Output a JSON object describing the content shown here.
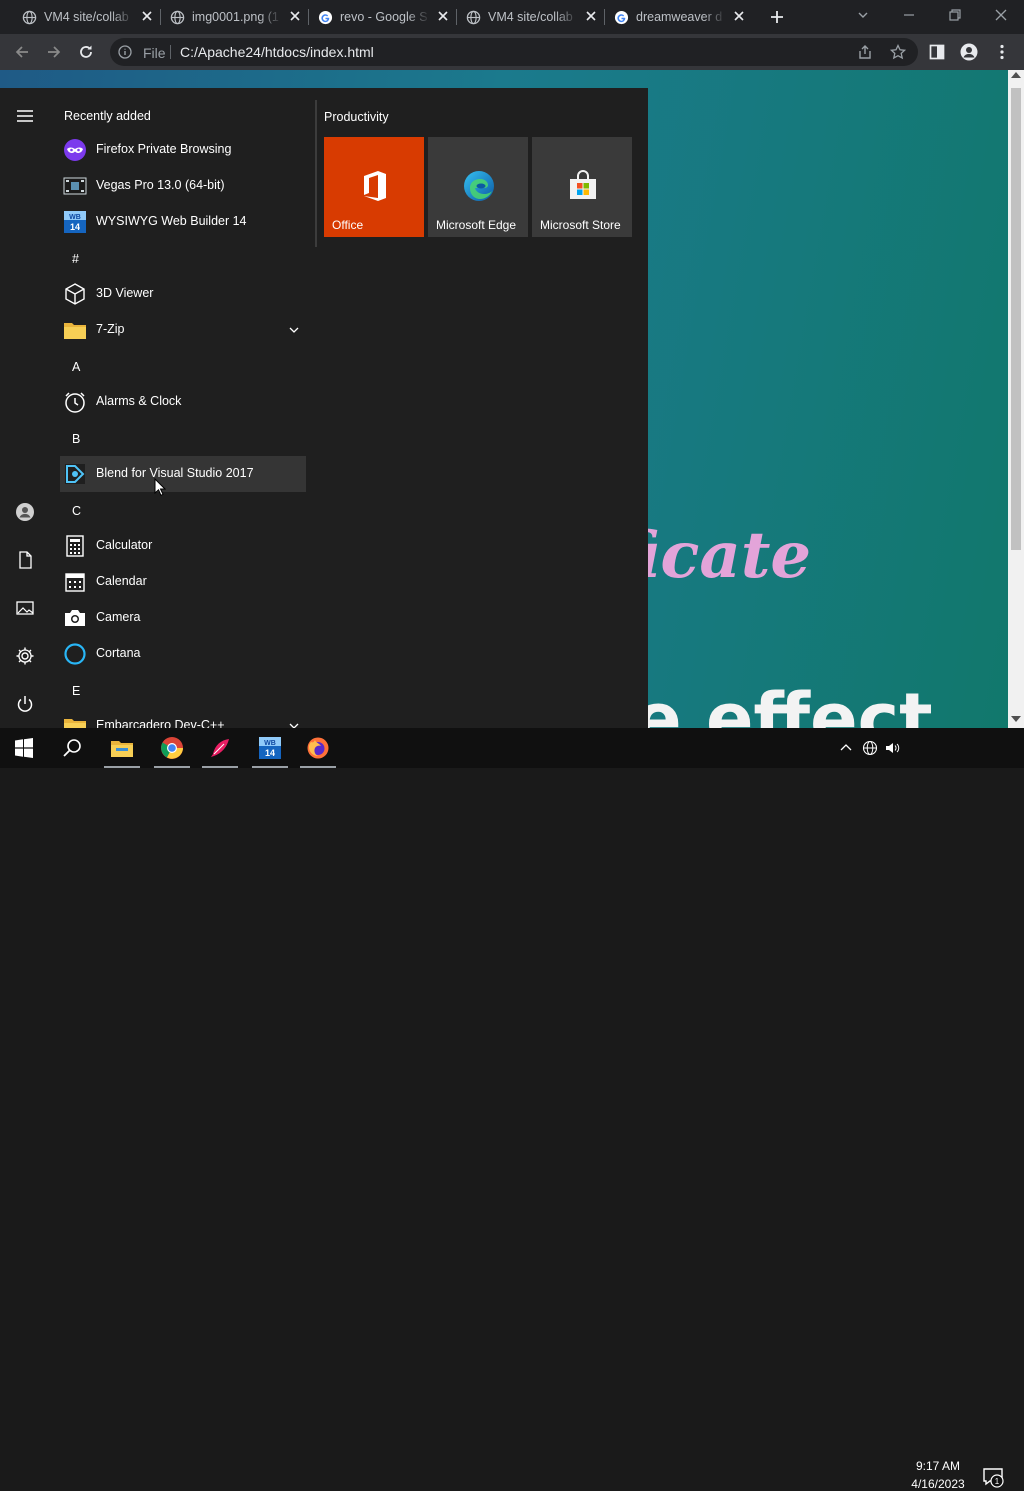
{
  "browser": {
    "tabs": [
      {
        "label": "VM4 site/collab",
        "icon": "globe-icon"
      },
      {
        "label": "img0001.png (1",
        "icon": "globe-icon"
      },
      {
        "label": "revo - Google S",
        "icon": "google-icon"
      },
      {
        "label": "VM4 site/collab",
        "icon": "globe-icon"
      },
      {
        "label": "dreamweaver d",
        "icon": "google-icon"
      }
    ],
    "address": {
      "scheme_label": "File",
      "url": "C:/Apache24/htdocs/index.html"
    }
  },
  "page": {
    "heading_partial": "tificate",
    "subheading_partial": "ble effect"
  },
  "start_menu": {
    "recent_header": "Recently added",
    "recent_apps": [
      {
        "label": "Firefox Private Browsing",
        "icon": "firefox-private-icon"
      },
      {
        "label": "Vegas Pro 13.0 (64-bit)",
        "icon": "vegas-icon"
      },
      {
        "label": "WYSIWYG Web Builder 14",
        "icon": "wysiwyg-icon"
      }
    ],
    "sections": [
      {
        "letter": "#",
        "apps": [
          {
            "label": "3D Viewer",
            "icon": "cube-icon"
          },
          {
            "label": "7-Zip",
            "icon": "folder-icon"
          }
        ]
      },
      {
        "letter": "A",
        "apps": [
          {
            "label": "Alarms & Clock",
            "icon": "clock-icon"
          }
        ]
      },
      {
        "letter": "B",
        "apps": [
          {
            "label": "Blend for Visual Studio 2017",
            "icon": "blend-icon"
          }
        ]
      },
      {
        "letter": "C",
        "apps": [
          {
            "label": "Calculator",
            "icon": "calculator-icon"
          },
          {
            "label": "Calendar",
            "icon": "calendar-icon"
          },
          {
            "label": "Camera",
            "icon": "camera-icon"
          },
          {
            "label": "Cortana",
            "icon": "cortana-icon"
          }
        ]
      },
      {
        "letter": "E",
        "apps": [
          {
            "label": "Embarcadero Dev-C++",
            "icon": "folder-icon"
          }
        ]
      }
    ],
    "productivity_header": "Productivity",
    "tiles": [
      {
        "label": "Office",
        "icon": "office-icon",
        "color": "#d83b01"
      },
      {
        "label": "Microsoft Edge",
        "icon": "edge-icon",
        "color": "#3a3a3a"
      },
      {
        "label": "Microsoft Store",
        "icon": "store-icon",
        "color": "#3a3a3a"
      }
    ]
  },
  "taskbar": {
    "time": "9:17 AM",
    "date": "4/16/2023",
    "notification_count": "1"
  }
}
